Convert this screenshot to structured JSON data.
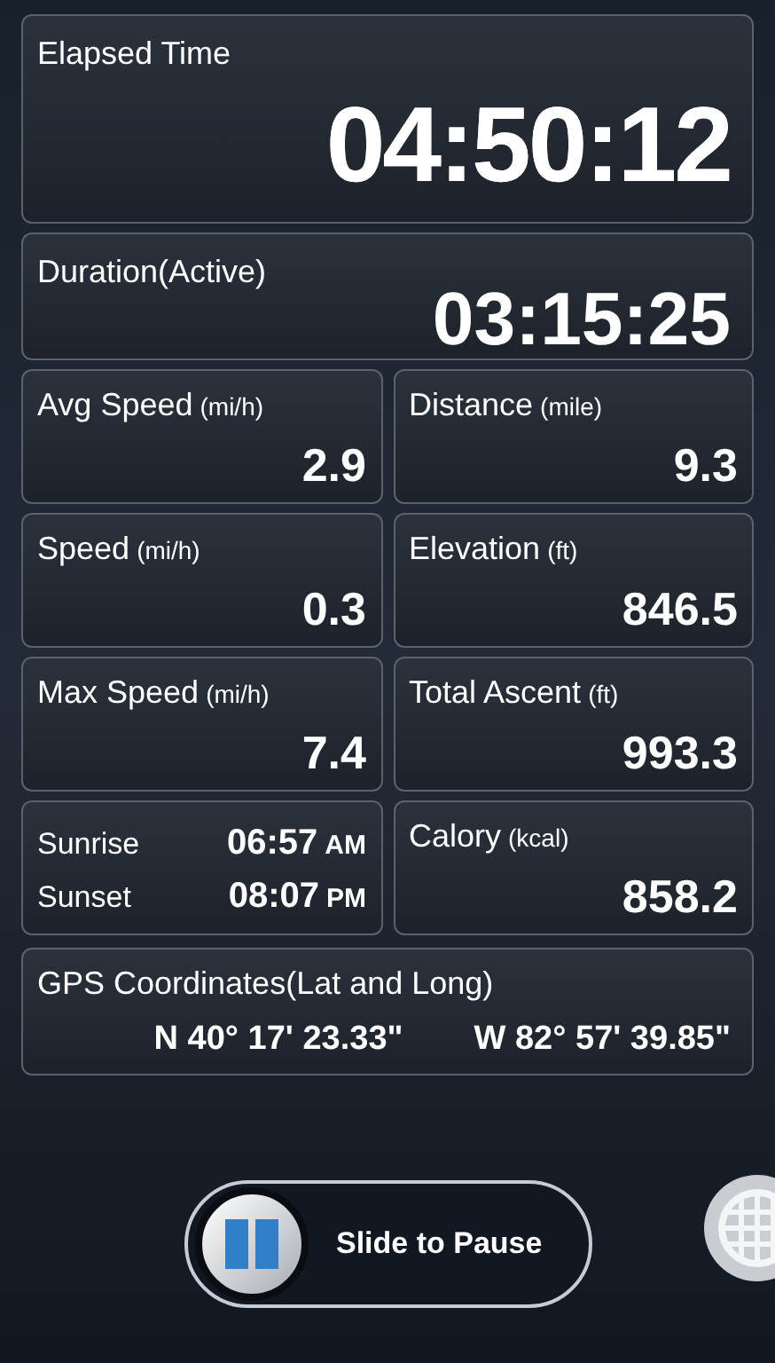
{
  "elapsed": {
    "label": "Elapsed Time",
    "value": "04:50:12"
  },
  "duration": {
    "label": "Duration(Active)",
    "value": "03:15:25"
  },
  "tiles": [
    {
      "kind": "metric",
      "label": "Avg Speed",
      "unit": "(mi/h)",
      "value": "2.9"
    },
    {
      "kind": "metric",
      "label": "Distance",
      "unit": "(mile)",
      "value": "9.3"
    },
    {
      "kind": "metric",
      "label": "Speed",
      "unit": "(mi/h)",
      "value": "0.3"
    },
    {
      "kind": "metric",
      "label": "Elevation",
      "unit": "(ft)",
      "value": "846.5"
    },
    {
      "kind": "metric",
      "label": "Max Speed",
      "unit": "(mi/h)",
      "value": "7.4"
    },
    {
      "kind": "metric",
      "label": "Total Ascent",
      "unit": "(ft)",
      "value": "993.3"
    },
    {
      "kind": "sun",
      "rows": [
        {
          "label": "Sunrise",
          "time": "06:57",
          "suffix": "AM"
        },
        {
          "label": "Sunset",
          "time": "08:07",
          "suffix": "PM"
        }
      ]
    },
    {
      "kind": "metric",
      "label": "Calory",
      "unit": "(kcal)",
      "value": "858.2"
    }
  ],
  "gps": {
    "label": "GPS Coordinates(Lat and Long)",
    "lat": "N 40° 17' 23.33\"",
    "long": "W 82° 57' 39.85\""
  },
  "slider": {
    "label": "Slide to Pause",
    "level": 0
  }
}
